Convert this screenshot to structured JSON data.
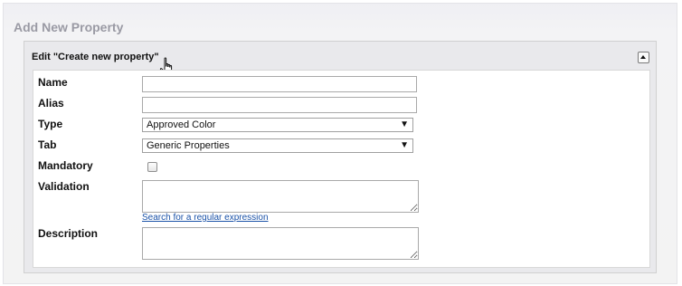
{
  "page": {
    "title": "Add New Property"
  },
  "panel": {
    "title": "Edit \"Create new property\""
  },
  "form": {
    "name": {
      "label": "Name",
      "value": ""
    },
    "alias": {
      "label": "Alias",
      "value": ""
    },
    "type": {
      "label": "Type",
      "selected": "Approved Color"
    },
    "tab": {
      "label": "Tab",
      "selected": "Generic Properties"
    },
    "mandatory": {
      "label": "Mandatory",
      "checked": false
    },
    "validation": {
      "label": "Validation",
      "value": "",
      "link_label": "Search for a regular expression"
    },
    "description": {
      "label": "Description",
      "value": ""
    }
  },
  "icons": {
    "collapse": "collapse-up-icon",
    "cursor": "hand-pointer-icon",
    "dropdown": "dropdown-arrow-icon"
  },
  "glyphs": {
    "dropdown_arrow": "▼"
  }
}
